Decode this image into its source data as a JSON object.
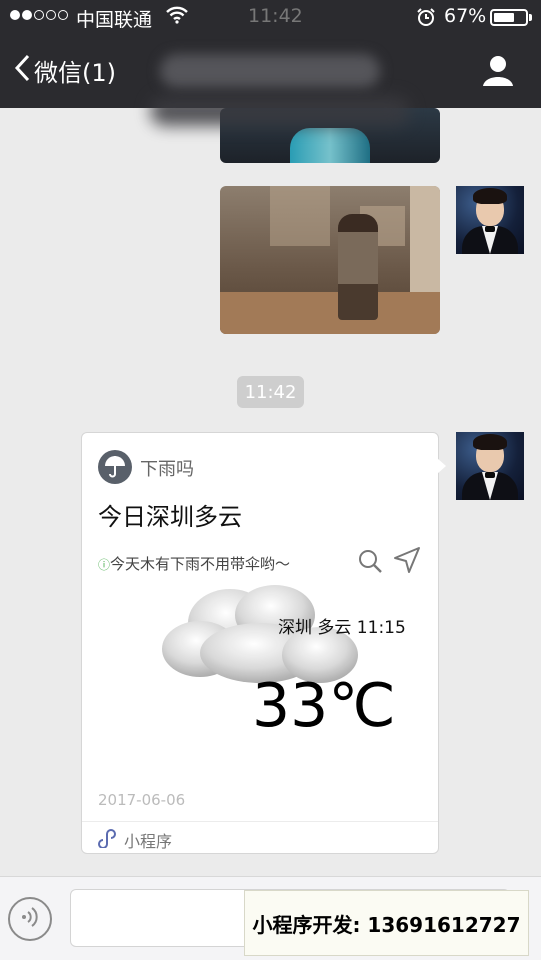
{
  "status_bar": {
    "carrier": "中国联通",
    "time": "11:42",
    "battery_percent": "67%",
    "battery_level": 0.67,
    "signal_bars_filled": 2,
    "signal_bars_total": 5,
    "icons": [
      "signal-icon",
      "wifi-icon",
      "alarm-icon",
      "battery-icon"
    ]
  },
  "nav": {
    "back_label": "微信(1)",
    "chat_title": "",
    "icons": [
      "back-chevron-icon",
      "profile-icon"
    ]
  },
  "chat": {
    "timestamp": "11:42"
  },
  "miniprogram_card": {
    "app_name": "下雨吗",
    "title": "今日深圳多云",
    "tip_mark": "ⓘ",
    "tip_text": "今天木有下雨不用带伞哟～",
    "location_time": "深圳  多云 11:15",
    "temperature": "33℃",
    "date": "2017-06-06",
    "footer_label": "小程序",
    "icons": [
      "umbrella-icon",
      "search-icon",
      "location-arrow-icon",
      "cloud-icon",
      "miniprogram-link-icon"
    ]
  },
  "input_bar": {
    "message_value": "",
    "icons": [
      "voice-icon"
    ]
  },
  "promo": {
    "text": "小程序开发:  13691612727"
  },
  "colors": {
    "bar_background": "#2b2b2f",
    "chat_background": "#ebebeb",
    "card_background": "#ffffff",
    "timestamp_badge": "#cecece"
  }
}
